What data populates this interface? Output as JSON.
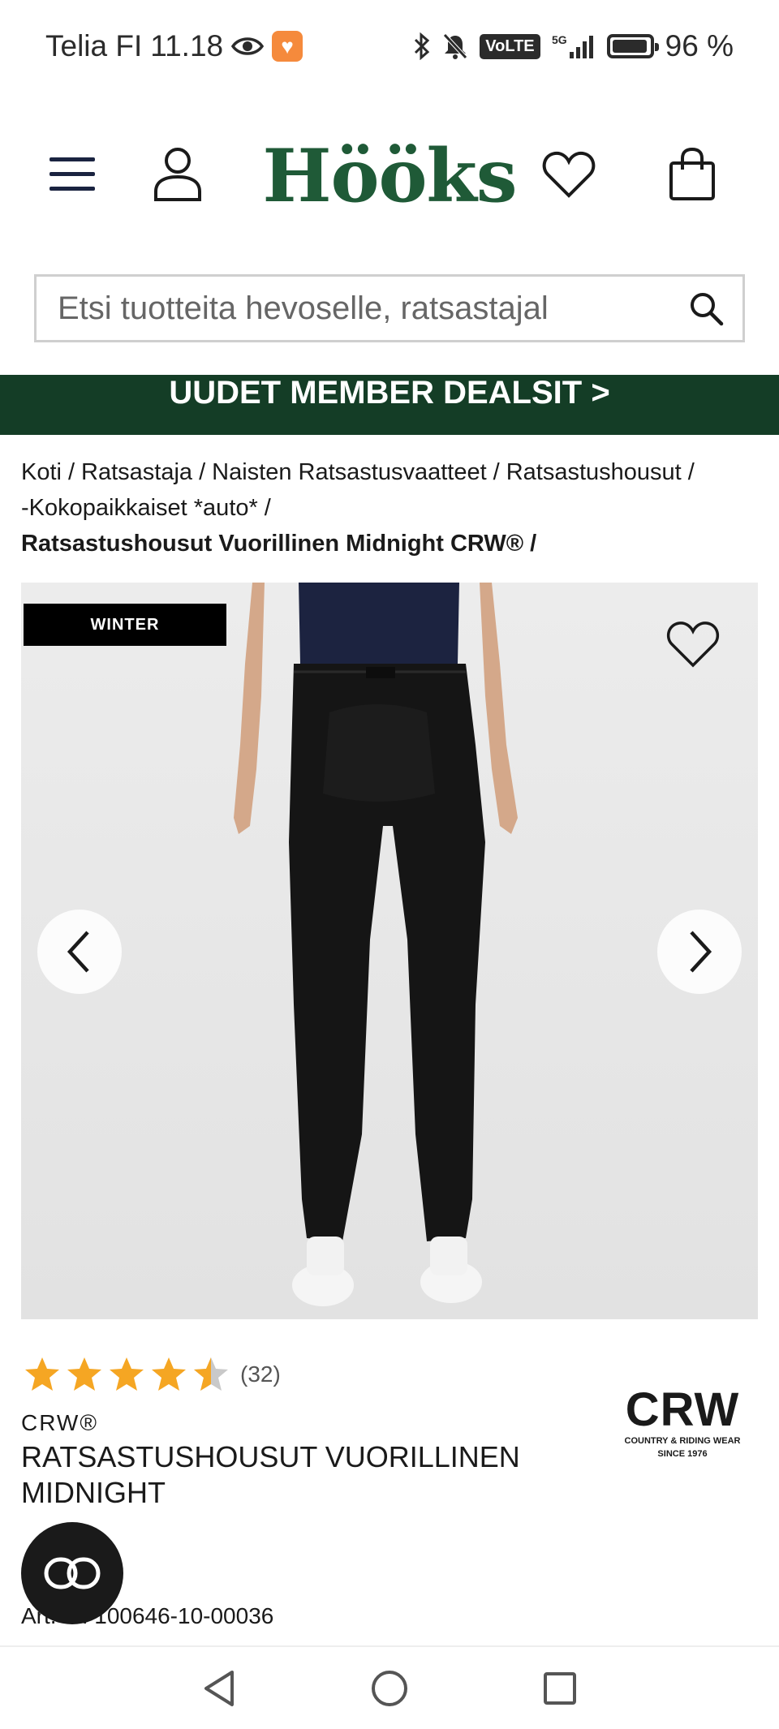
{
  "status_bar": {
    "carrier": "Telia FI",
    "time": "11.18",
    "network": "5G",
    "volte": "VoLTE",
    "battery": "96 %",
    "battery_level": 0.96
  },
  "header": {
    "logo": "Hööks",
    "logo_color": "#1f5a37"
  },
  "search": {
    "placeholder": "Etsi tuotteita hevoselle, ratsastajal"
  },
  "promo": {
    "text": "UUDET MEMBER DEALSIT >",
    "background": "#143d26"
  },
  "breadcrumb": {
    "items": [
      "Koti",
      "Ratsastaja",
      "Naisten Ratsastusvaatteet",
      "Ratsastushousut",
      "-Kokopaikkaiset *auto*"
    ],
    "current": "Ratsastushousut Vuorillinen Midnight CRW®",
    "separator": "/"
  },
  "product": {
    "badge": "WINTER",
    "rating": 4.5,
    "review_count": "(32)",
    "brand": "CRW®",
    "name": "RATSASTUSHOUSUT VUORILLINEN MIDNIGHT",
    "brand_logo_text": "CRW",
    "brand_logo_tagline": "COUNTRY & RIDING WEAR",
    "brand_logo_since": "SINCE 1976",
    "article_number": "Art. nr. 100646-10-00036",
    "star_color": "#f5a623"
  }
}
